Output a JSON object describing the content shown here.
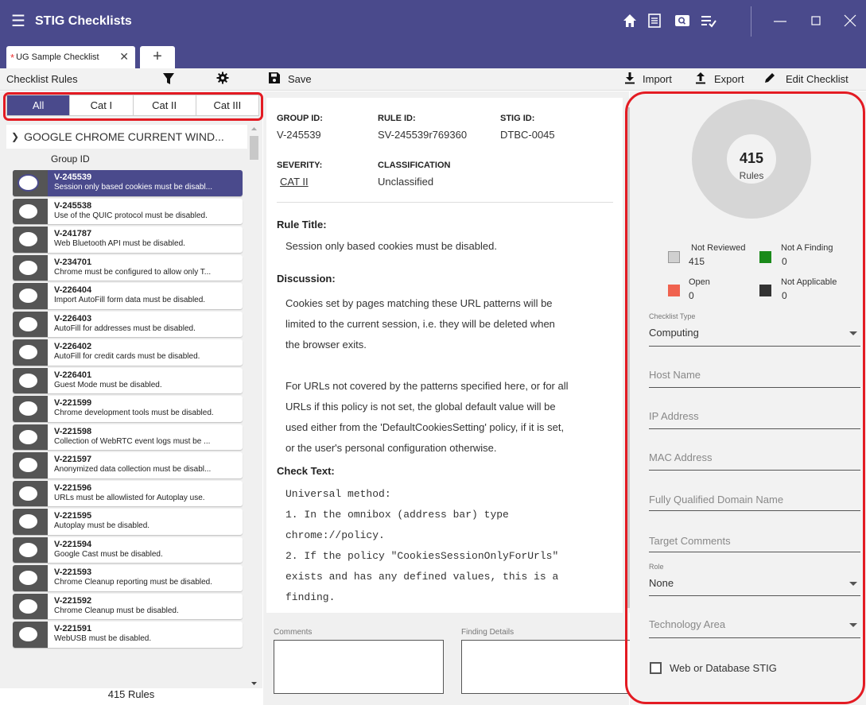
{
  "app": {
    "title": "STIG Checklists"
  },
  "tabs": [
    {
      "label": "UG Sample Checklist",
      "modified": "*"
    }
  ],
  "toolbar": {
    "rules_label": "Checklist Rules",
    "save_label": "Save",
    "import_label": "Import",
    "export_label": "Export",
    "edit_label": "Edit Checklist"
  },
  "cat_tabs": [
    "All",
    "Cat I",
    "Cat II",
    "Cat III"
  ],
  "group": {
    "name": "GOOGLE CHROME CURRENT WIND...",
    "column_header": "Group ID"
  },
  "rules": [
    {
      "id": "V-245539",
      "text": "Session only based cookies must be disabl..."
    },
    {
      "id": "V-245538",
      "text": "Use of the QUIC protocol must be disabled."
    },
    {
      "id": "V-241787",
      "text": "Web Bluetooth API must be disabled."
    },
    {
      "id": "V-234701",
      "text": "Chrome must be configured to allow only T..."
    },
    {
      "id": "V-226404",
      "text": "Import AutoFill form data must be disabled."
    },
    {
      "id": "V-226403",
      "text": "AutoFill for addresses must be disabled."
    },
    {
      "id": "V-226402",
      "text": "AutoFill for credit cards must be disabled."
    },
    {
      "id": "V-226401",
      "text": "Guest Mode must be disabled."
    },
    {
      "id": "V-221599",
      "text": "Chrome development tools must be disabled."
    },
    {
      "id": "V-221598",
      "text": "Collection of WebRTC event logs must be ..."
    },
    {
      "id": "V-221597",
      "text": "Anonymized data collection must be disabl..."
    },
    {
      "id": "V-221596",
      "text": "URLs must be allowlisted for Autoplay use."
    },
    {
      "id": "V-221595",
      "text": "Autoplay must be disabled."
    },
    {
      "id": "V-221594",
      "text": "Google Cast must be disabled."
    },
    {
      "id": "V-221593",
      "text": "Chrome Cleanup reporting must be disabled."
    },
    {
      "id": "V-221592",
      "text": "Chrome Cleanup must be disabled."
    },
    {
      "id": "V-221591",
      "text": "WebUSB must be disabled."
    }
  ],
  "rules_count": "415 Rules",
  "detail": {
    "group_id_label": "GROUP ID:",
    "group_id": "V-245539",
    "rule_id_label": "RULE ID:",
    "rule_id": "SV-245539r769360",
    "stig_id_label": "STIG ID:",
    "stig_id": "DTBC-0045",
    "severity_label": "SEVERITY:",
    "severity": "CAT II",
    "classification_label": "CLASSIFICATION",
    "classification": "Unclassified",
    "rule_title_label": "Rule Title:",
    "rule_title": "Session only based cookies must be disabled.",
    "discussion_label": "Discussion:",
    "discussion_lines": [
      "Cookies set by pages matching these URL patterns will be",
      "limited to the current session, i.e. they will be deleted when",
      "the browser exits.",
      "",
      "For URLs not covered by the patterns specified here, or for all",
      "URLs if this policy is not set, the global default value will be",
      "used either from the 'DefaultCookiesSetting' policy, if it is set,",
      "or the user's personal configuration otherwise."
    ],
    "check_text_label": "Check Text:",
    "check_lines": [
      "Universal method:",
      "1. In the omnibox (address bar) type",
      "chrome://policy.",
      "2. If the policy \"CookiesSessionOnlyForUrls\"",
      "exists and has any defined values, this is a",
      "finding."
    ],
    "comments_label": "Comments",
    "finding_details_label": "Finding Details"
  },
  "summary": {
    "total": "415",
    "total_label": "Rules",
    "legend": [
      {
        "label": "Not Reviewed",
        "value": "415",
        "color": "#d0d0d0"
      },
      {
        "label": "Not A Finding",
        "value": "0",
        "color": "#1a8a1a"
      },
      {
        "label": "Open",
        "value": "0",
        "color": "#f0624f"
      },
      {
        "label": "Not Applicable",
        "value": "0",
        "color": "#333333"
      }
    ]
  },
  "target": {
    "checklist_type_label": "Checklist Type",
    "checklist_type": "Computing",
    "host_name": "Host Name",
    "ip_address": "IP Address",
    "mac_address": "MAC Address",
    "fqdn": "Fully Qualified Domain Name",
    "target_comments": "Target Comments",
    "role_label": "Role",
    "role": "None",
    "technology_area": "Technology Area",
    "web_db_stig": "Web or Database STIG"
  }
}
